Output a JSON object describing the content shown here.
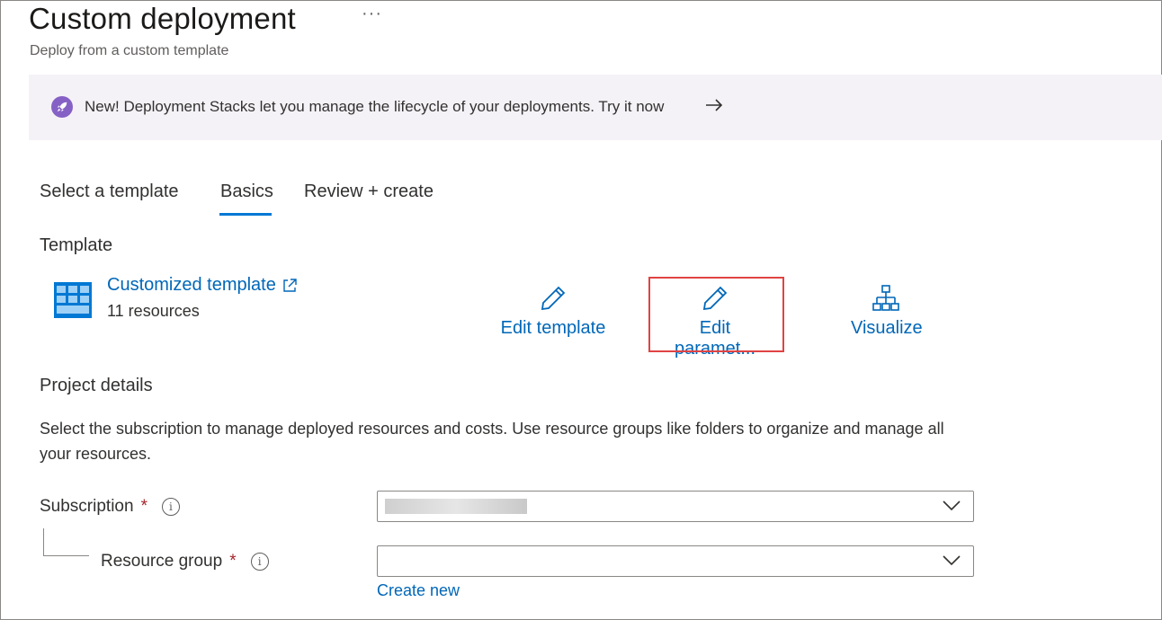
{
  "header": {
    "title": "Custom deployment",
    "more": "···",
    "subtitle": "Deploy from a custom template"
  },
  "banner": {
    "text": "New! Deployment Stacks let you manage the lifecycle of your deployments. Try it now",
    "icon": "rocket-icon",
    "arrow_icon": "arrow-right-icon",
    "accent": "#8661c5"
  },
  "tabs": [
    {
      "label": "Select a template",
      "active": false
    },
    {
      "label": "Basics",
      "active": true
    },
    {
      "label": "Review + create",
      "active": false
    }
  ],
  "template": {
    "section_title": "Template",
    "link_label": "Customized template",
    "resources": "11 resources",
    "actions": {
      "edit_template": "Edit template",
      "edit_parameters": "Edit paramet...",
      "visualize": "Visualize"
    }
  },
  "project": {
    "section_title": "Project details",
    "description": "Select the subscription to manage deployed resources and costs. Use resource groups like folders to organize and manage all your resources.",
    "subscription": {
      "label": "Subscription",
      "required": "*",
      "value": ""
    },
    "resource_group": {
      "label": "Resource group",
      "required": "*",
      "value": ""
    },
    "create_new": "Create new"
  },
  "colors": {
    "link": "#0067b8",
    "tab_active": "#0078d4",
    "highlight": "#e04343",
    "banner_bg": "#f5f2f7"
  }
}
